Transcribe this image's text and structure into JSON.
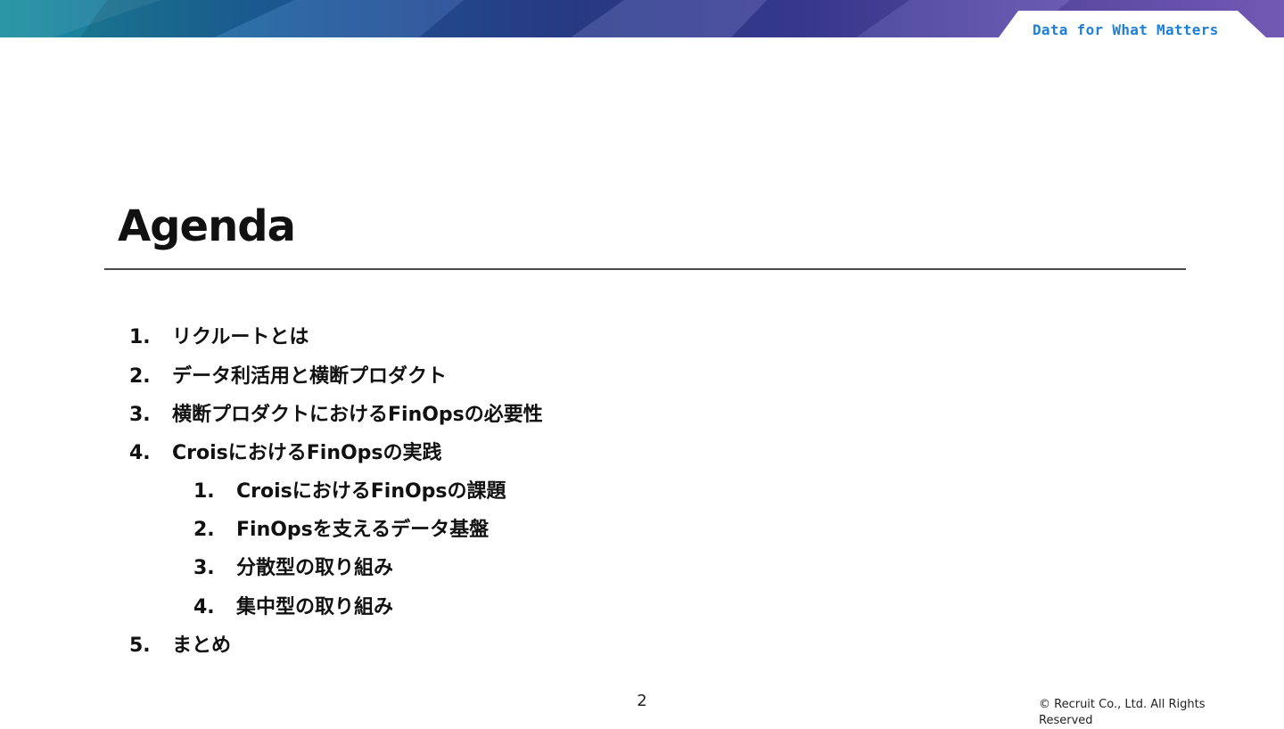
{
  "header": {
    "tagline": "Data for What Matters"
  },
  "slide": {
    "title": "Agenda",
    "agenda": [
      {
        "num": "1.",
        "text": "リクルートとは"
      },
      {
        "num": "2.",
        "text": "データ利活用と横断プロダクト"
      },
      {
        "num": "3.",
        "text": "横断プロダクトにおけるFinOpsの必要性"
      },
      {
        "num": "4.",
        "text": "CroisにおけるFinOpsの実践",
        "children": [
          {
            "num": "1.",
            "text": "CroisにおけるFinOpsの課題"
          },
          {
            "num": "2.",
            "text": "FinOpsを支えるデータ基盤"
          },
          {
            "num": "3.",
            "text": "分散型の取り組み"
          },
          {
            "num": "4.",
            "text": "集中型の取り組み"
          }
        ]
      },
      {
        "num": "5.",
        "text": "まとめ"
      }
    ]
  },
  "footer": {
    "page_number": "2",
    "copyright": "© Recruit Co., Ltd. All Rights Reserved"
  },
  "colors": {
    "tagline": "#1d7fd6",
    "rule": "#4a4a4a",
    "banner_start": "#1a8f9e",
    "banner_end": "#7a5fc0"
  }
}
